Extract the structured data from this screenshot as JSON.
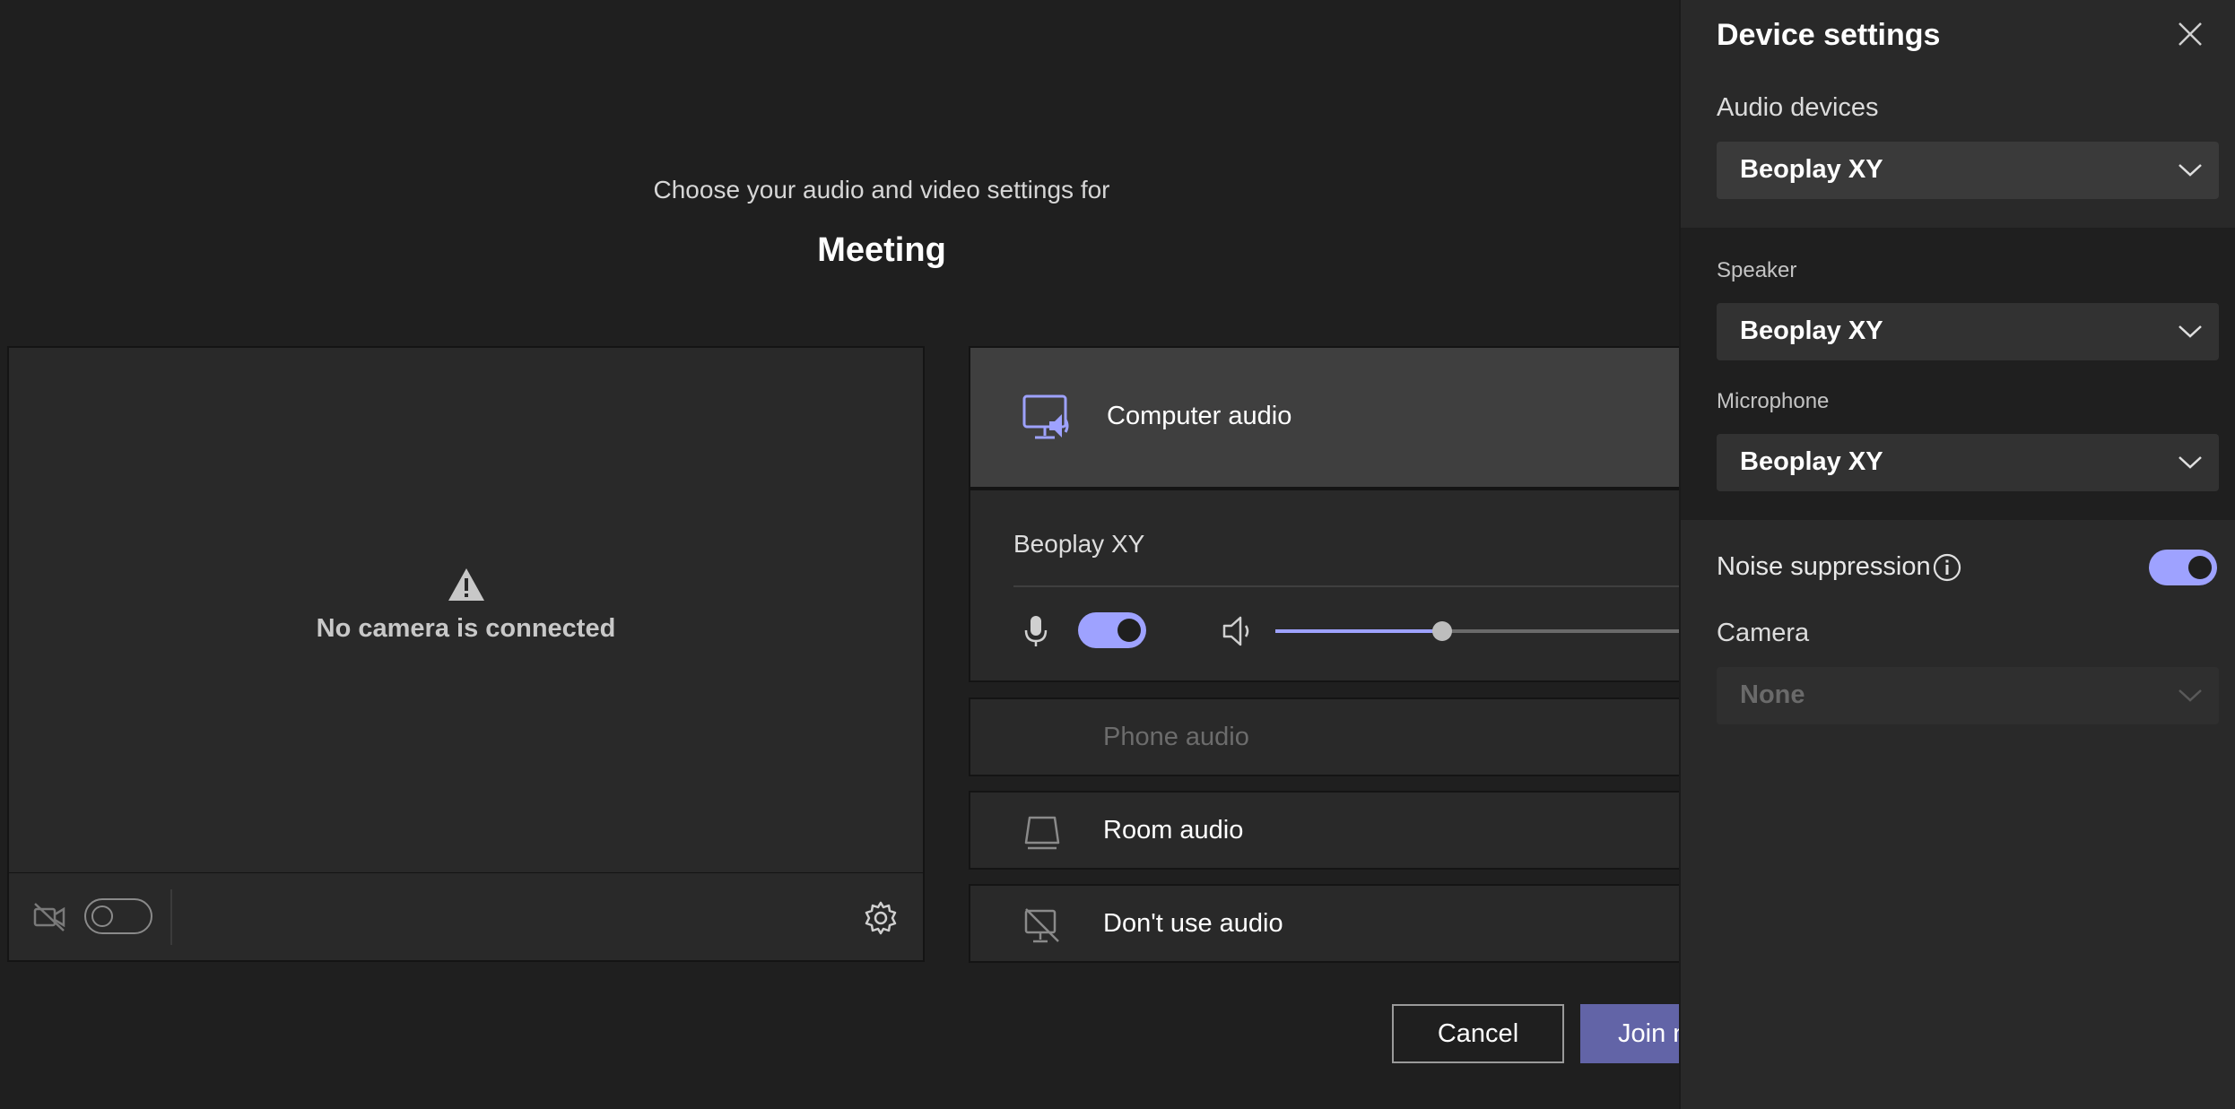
{
  "header": {
    "subtitle": "Choose your audio and video settings for",
    "title": "Meeting"
  },
  "preview": {
    "message": "No camera is connected",
    "camera_toggle": "off"
  },
  "audio": {
    "computer_audio_label": "Computer audio",
    "device_name": "Beoplay XY",
    "mic_toggle": "on",
    "speaker_volume_percent": 31,
    "phone_audio_label": "Phone audio",
    "room_audio_label": "Room audio",
    "no_audio_label": "Don't use audio"
  },
  "buttons": {
    "cancel_label": "Cancel",
    "join_label": "Join n"
  },
  "panel": {
    "title": "Device settings",
    "audio_devices_label": "Audio devices",
    "audio_devices_value": "Beoplay XY",
    "speaker_label": "Speaker",
    "speaker_value": "Beoplay XY",
    "microphone_label": "Microphone",
    "microphone_value": "Beoplay XY",
    "noise_suppression_label": "Noise suppression",
    "noise_suppression": "on",
    "camera_label": "Camera",
    "camera_value": "None"
  },
  "colors": {
    "accent": "#9ea2ff",
    "join_button": "#6264a7",
    "background": "#1f1f1f"
  }
}
